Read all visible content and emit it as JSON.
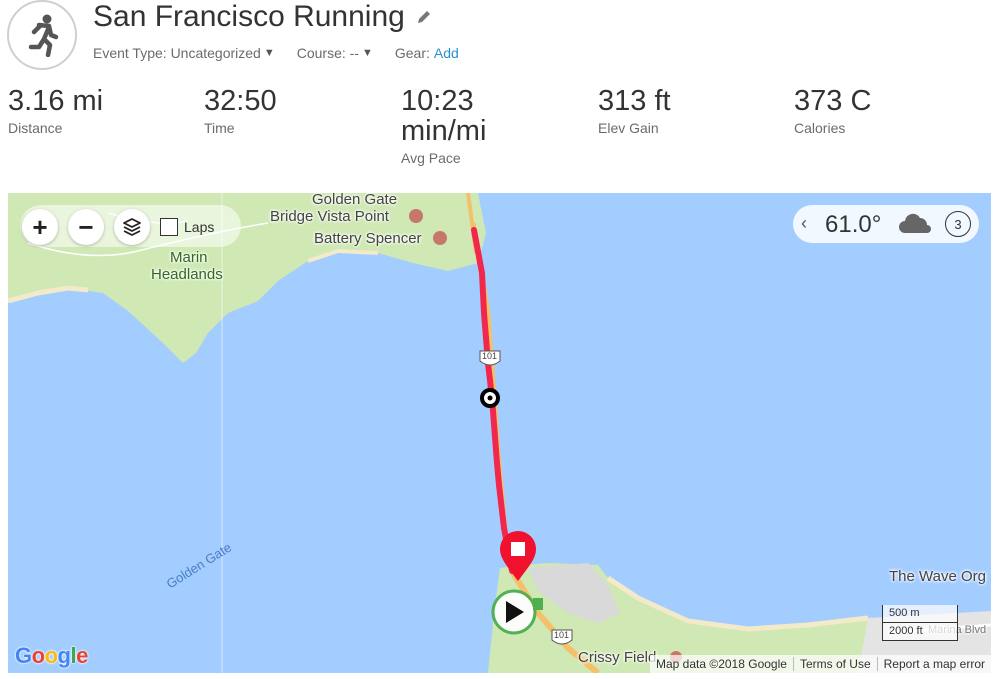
{
  "activity": {
    "title": "San Francisco Running",
    "icon": "runner-icon",
    "event_type_label": "Event Type: Uncategorized",
    "course_label": "Course: --",
    "gear_label": "Gear:",
    "gear_link": "Add"
  },
  "stats": [
    {
      "value": "3.16 mi",
      "label": "Distance"
    },
    {
      "value": "32:50",
      "label": "Time"
    },
    {
      "value": "10:23",
      "value2": "min/mi",
      "label": "Avg Pace"
    },
    {
      "value": "313 ft",
      "label": "Elev Gain"
    },
    {
      "value": "373 C",
      "label": "Calories"
    }
  ],
  "map": {
    "controls": {
      "zoom_in": "+",
      "zoom_out": "−",
      "laps_label": "Laps"
    },
    "weather": {
      "temperature": "61.0°",
      "wind": "3",
      "condition_icon": "cloud-icon"
    },
    "labels": {
      "golden_gate_bridge_vista": "Golden Gate",
      "bridge_vista_point": "Bridge Vista Point",
      "battery_spencer": "Battery Spencer",
      "marin": "Marin",
      "headlands": "Headlands",
      "golden_gate_water": "Golden Gate",
      "the_wave": "The Wave Org",
      "crissy_field": "Crissy Field",
      "marina_blvd": "Marina Blvd",
      "route_101_a": "101",
      "route_101_b": "101"
    },
    "google_logo": "Google",
    "attribution": {
      "map_data": "Map data ©2018 Google",
      "terms": "Terms of Use",
      "report": "Report a map error"
    },
    "scale": {
      "metric": "500 m",
      "imperial": "2000 ft"
    },
    "colors": {
      "water": "#a3ccff",
      "land": "#cfe8b4",
      "route": "#f2274c",
      "start": "#4caf50",
      "stop": "#f0112f"
    }
  }
}
